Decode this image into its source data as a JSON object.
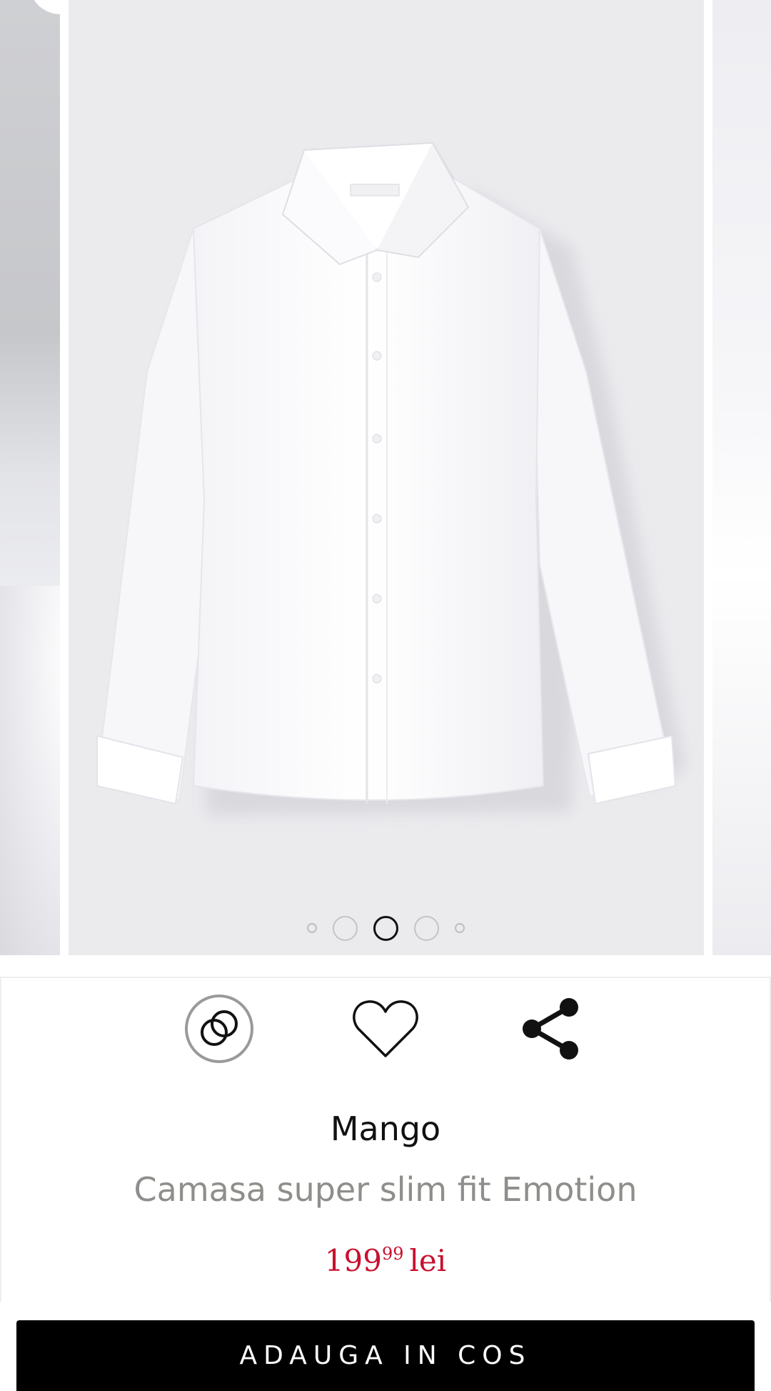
{
  "gallery": {
    "slides_count": 5,
    "active_slide": 3,
    "image_description_icon": "white-shirt-image"
  },
  "actions": {
    "compare_icon": "compare-rings-icon",
    "favorite_icon": "heart-icon",
    "share_icon": "share-icon"
  },
  "product": {
    "brand": "Mango",
    "name": "Camasa super slim fit Emotion",
    "price_int": "199",
    "price_dec": "99",
    "currency": "lei"
  },
  "cart": {
    "label": "ADAUGA IN COS"
  },
  "colors": {
    "price": "#c8102e",
    "button_bg": "#000000",
    "secondary_text": "#8f8e8a"
  }
}
